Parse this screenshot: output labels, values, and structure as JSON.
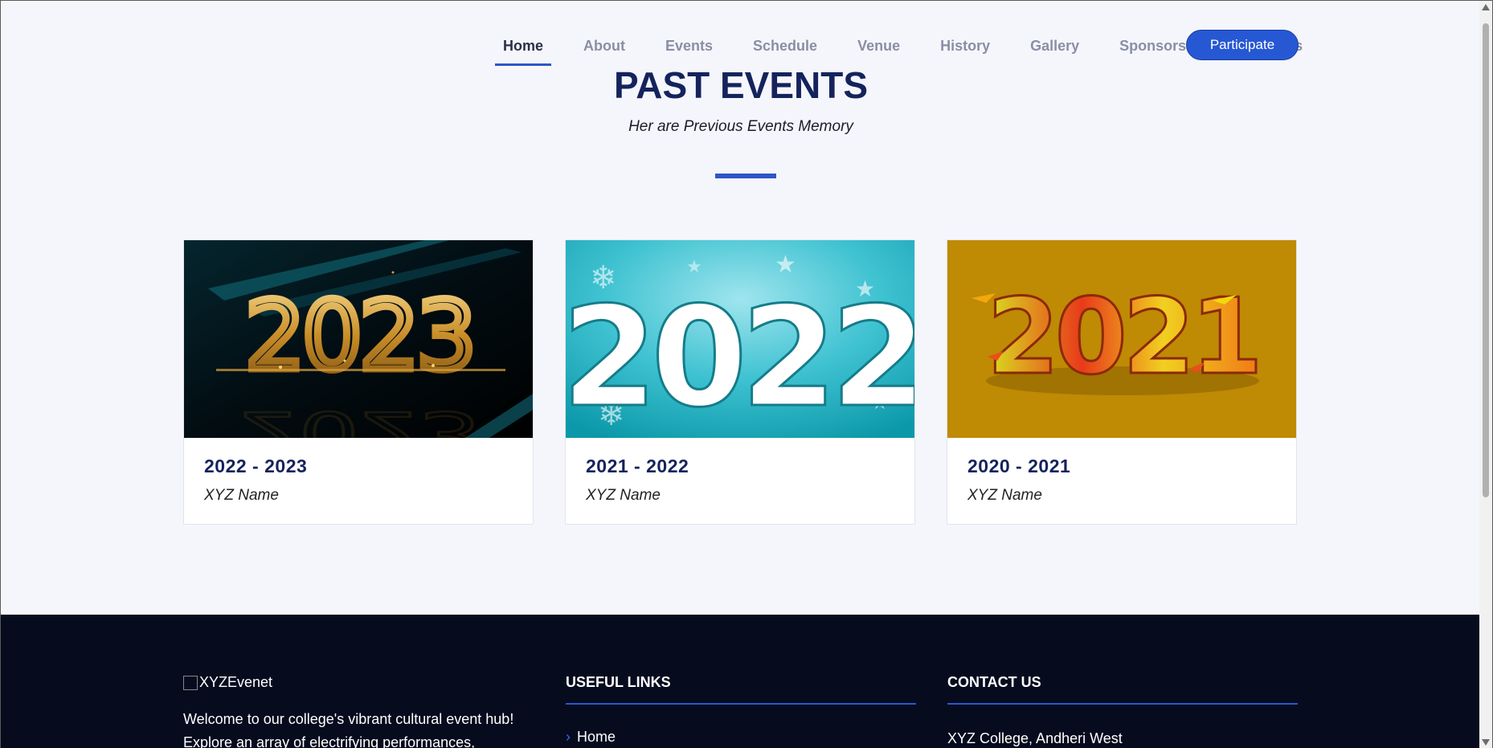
{
  "nav": {
    "items": [
      {
        "label": "Home",
        "active": true
      },
      {
        "label": "About"
      },
      {
        "label": "Events"
      },
      {
        "label": "Schedule"
      },
      {
        "label": "Venue"
      },
      {
        "label": "History"
      },
      {
        "label": "Gallery"
      },
      {
        "label": "Sponsors"
      },
      {
        "label": "Contact Us"
      }
    ],
    "cta": "Participate"
  },
  "section": {
    "title": "PAST EVENTS",
    "subtitle": "Her are Previous Events Memory"
  },
  "cards": [
    {
      "year_image": "2023",
      "title": "2022 - 2023",
      "name": "XYZ Name"
    },
    {
      "year_image": "2022",
      "title": "2021 - 2022",
      "name": "XYZ Name"
    },
    {
      "year_image": "2021",
      "title": "2020 - 2021",
      "name": "XYZ Name"
    }
  ],
  "footer": {
    "logo_alt": "XYZEvenet",
    "description": "Welcome to our college's vibrant cultural event hub! Explore an array of electrifying performances,",
    "useful_links_heading": "USEFUL LINKS",
    "useful_links": [
      "Home"
    ],
    "contact_heading": "CONTACT US",
    "address_line1": "XYZ College, Andheri West"
  },
  "colors": {
    "accent": "#2658d3",
    "title": "#14235c",
    "footer_bg": "#060b1e"
  }
}
